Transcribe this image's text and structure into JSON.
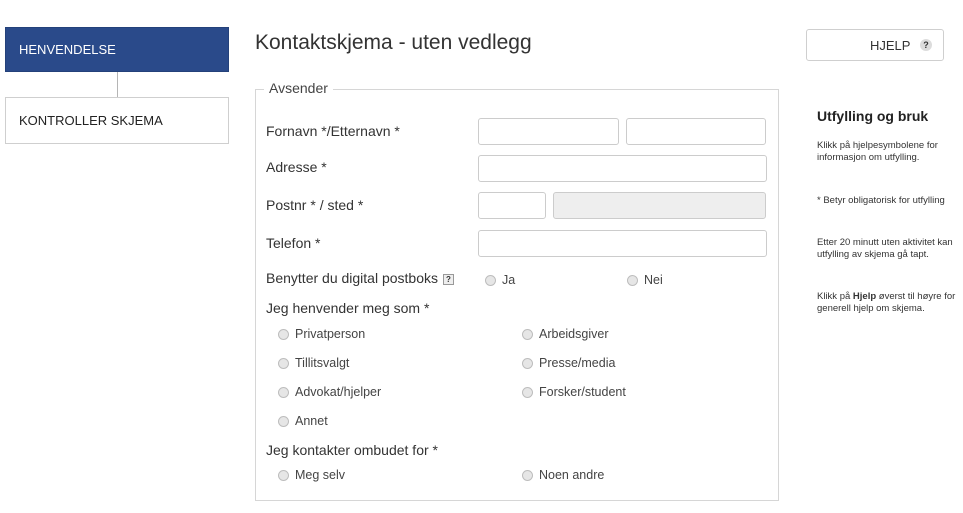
{
  "steps": {
    "active_label": "HENVENDELSE",
    "inactive_label": "KONTROLLER SKJEMA"
  },
  "header": {
    "title": "Kontaktskjema - uten vedlegg",
    "help_label": "HJELP",
    "help_icon": "?"
  },
  "form": {
    "legend": "Avsender",
    "name_label": "Fornavn */Etternavn *",
    "address_label": "Adresse *",
    "postal_label": "Postnr * / sted *",
    "phone_label": "Telefon *",
    "digital_mailbox_label": "Benytter du digital postboks",
    "digital_mailbox_help": "?",
    "digital_mailbox_options": [
      "Ja",
      "Nei"
    ],
    "role_label": "Jeg henvender meg som *",
    "role_options": [
      "Privatperson",
      "Arbeidsgiver",
      "Tillitsvalgt",
      "Presse/media",
      "Advokat/hjelper",
      "Forsker/student",
      "Annet"
    ],
    "contact_for_label": "Jeg kontakter ombudet for *",
    "contact_for_options": [
      "Meg selv",
      "Noen andre"
    ]
  },
  "sidebar": {
    "title": "Utfylling og bruk",
    "p1": "Klikk på hjelpesymbolene for informasjon om utfylling.",
    "p2": "* Betyr obligatorisk for utfylling",
    "p3": "Etter 20 minutt uten aktivitet kan utfylling av skjema gå tapt.",
    "p4_prefix": "Klikk på ",
    "p4_bold": "Hjelp",
    "p4_suffix": " øverst til høyre for generell hjelp om skjema."
  }
}
